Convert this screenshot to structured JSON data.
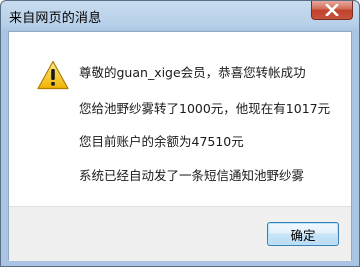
{
  "window": {
    "title": "来自网页的消息"
  },
  "icons": {
    "close": "close-icon",
    "warning": "warning-icon"
  },
  "message": {
    "line1": "尊敬的guan_xige会员，恭喜您转帐成功",
    "line2": "您给池野纱雾转了1000元，他现在有1017元",
    "line3": "您目前账户的余额为47510元",
    "line4": "系统已经自动发了一条短信通知池野纱雾"
  },
  "buttons": {
    "ok_label": "确定"
  },
  "colors": {
    "titlebar": "#b7cfe8",
    "close_button": "#c8533c",
    "warning_fill": "#f5c518",
    "button_border": "#3c7fb1"
  }
}
